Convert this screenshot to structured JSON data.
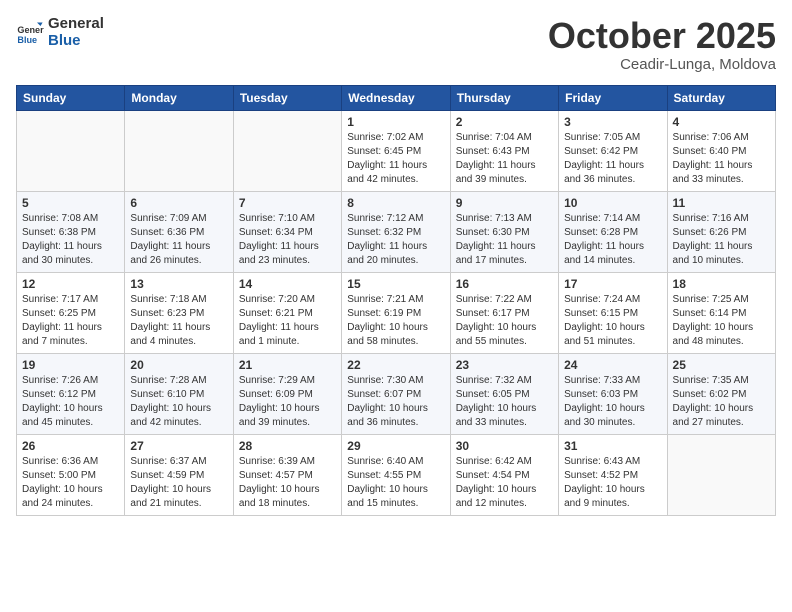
{
  "header": {
    "logo_line1": "General",
    "logo_line2": "Blue",
    "month": "October 2025",
    "location": "Ceadir-Lunga, Moldova"
  },
  "weekdays": [
    "Sunday",
    "Monday",
    "Tuesday",
    "Wednesday",
    "Thursday",
    "Friday",
    "Saturday"
  ],
  "weeks": [
    [
      {
        "day": "",
        "info": ""
      },
      {
        "day": "",
        "info": ""
      },
      {
        "day": "",
        "info": ""
      },
      {
        "day": "1",
        "info": "Sunrise: 7:02 AM\nSunset: 6:45 PM\nDaylight: 11 hours\nand 42 minutes."
      },
      {
        "day": "2",
        "info": "Sunrise: 7:04 AM\nSunset: 6:43 PM\nDaylight: 11 hours\nand 39 minutes."
      },
      {
        "day": "3",
        "info": "Sunrise: 7:05 AM\nSunset: 6:42 PM\nDaylight: 11 hours\nand 36 minutes."
      },
      {
        "day": "4",
        "info": "Sunrise: 7:06 AM\nSunset: 6:40 PM\nDaylight: 11 hours\nand 33 minutes."
      }
    ],
    [
      {
        "day": "5",
        "info": "Sunrise: 7:08 AM\nSunset: 6:38 PM\nDaylight: 11 hours\nand 30 minutes."
      },
      {
        "day": "6",
        "info": "Sunrise: 7:09 AM\nSunset: 6:36 PM\nDaylight: 11 hours\nand 26 minutes."
      },
      {
        "day": "7",
        "info": "Sunrise: 7:10 AM\nSunset: 6:34 PM\nDaylight: 11 hours\nand 23 minutes."
      },
      {
        "day": "8",
        "info": "Sunrise: 7:12 AM\nSunset: 6:32 PM\nDaylight: 11 hours\nand 20 minutes."
      },
      {
        "day": "9",
        "info": "Sunrise: 7:13 AM\nSunset: 6:30 PM\nDaylight: 11 hours\nand 17 minutes."
      },
      {
        "day": "10",
        "info": "Sunrise: 7:14 AM\nSunset: 6:28 PM\nDaylight: 11 hours\nand 14 minutes."
      },
      {
        "day": "11",
        "info": "Sunrise: 7:16 AM\nSunset: 6:26 PM\nDaylight: 11 hours\nand 10 minutes."
      }
    ],
    [
      {
        "day": "12",
        "info": "Sunrise: 7:17 AM\nSunset: 6:25 PM\nDaylight: 11 hours\nand 7 minutes."
      },
      {
        "day": "13",
        "info": "Sunrise: 7:18 AM\nSunset: 6:23 PM\nDaylight: 11 hours\nand 4 minutes."
      },
      {
        "day": "14",
        "info": "Sunrise: 7:20 AM\nSunset: 6:21 PM\nDaylight: 11 hours\nand 1 minute."
      },
      {
        "day": "15",
        "info": "Sunrise: 7:21 AM\nSunset: 6:19 PM\nDaylight: 10 hours\nand 58 minutes."
      },
      {
        "day": "16",
        "info": "Sunrise: 7:22 AM\nSunset: 6:17 PM\nDaylight: 10 hours\nand 55 minutes."
      },
      {
        "day": "17",
        "info": "Sunrise: 7:24 AM\nSunset: 6:15 PM\nDaylight: 10 hours\nand 51 minutes."
      },
      {
        "day": "18",
        "info": "Sunrise: 7:25 AM\nSunset: 6:14 PM\nDaylight: 10 hours\nand 48 minutes."
      }
    ],
    [
      {
        "day": "19",
        "info": "Sunrise: 7:26 AM\nSunset: 6:12 PM\nDaylight: 10 hours\nand 45 minutes."
      },
      {
        "day": "20",
        "info": "Sunrise: 7:28 AM\nSunset: 6:10 PM\nDaylight: 10 hours\nand 42 minutes."
      },
      {
        "day": "21",
        "info": "Sunrise: 7:29 AM\nSunset: 6:09 PM\nDaylight: 10 hours\nand 39 minutes."
      },
      {
        "day": "22",
        "info": "Sunrise: 7:30 AM\nSunset: 6:07 PM\nDaylight: 10 hours\nand 36 minutes."
      },
      {
        "day": "23",
        "info": "Sunrise: 7:32 AM\nSunset: 6:05 PM\nDaylight: 10 hours\nand 33 minutes."
      },
      {
        "day": "24",
        "info": "Sunrise: 7:33 AM\nSunset: 6:03 PM\nDaylight: 10 hours\nand 30 minutes."
      },
      {
        "day": "25",
        "info": "Sunrise: 7:35 AM\nSunset: 6:02 PM\nDaylight: 10 hours\nand 27 minutes."
      }
    ],
    [
      {
        "day": "26",
        "info": "Sunrise: 6:36 AM\nSunset: 5:00 PM\nDaylight: 10 hours\nand 24 minutes."
      },
      {
        "day": "27",
        "info": "Sunrise: 6:37 AM\nSunset: 4:59 PM\nDaylight: 10 hours\nand 21 minutes."
      },
      {
        "day": "28",
        "info": "Sunrise: 6:39 AM\nSunset: 4:57 PM\nDaylight: 10 hours\nand 18 minutes."
      },
      {
        "day": "29",
        "info": "Sunrise: 6:40 AM\nSunset: 4:55 PM\nDaylight: 10 hours\nand 15 minutes."
      },
      {
        "day": "30",
        "info": "Sunrise: 6:42 AM\nSunset: 4:54 PM\nDaylight: 10 hours\nand 12 minutes."
      },
      {
        "day": "31",
        "info": "Sunrise: 6:43 AM\nSunset: 4:52 PM\nDaylight: 10 hours\nand 9 minutes."
      },
      {
        "day": "",
        "info": ""
      }
    ]
  ]
}
